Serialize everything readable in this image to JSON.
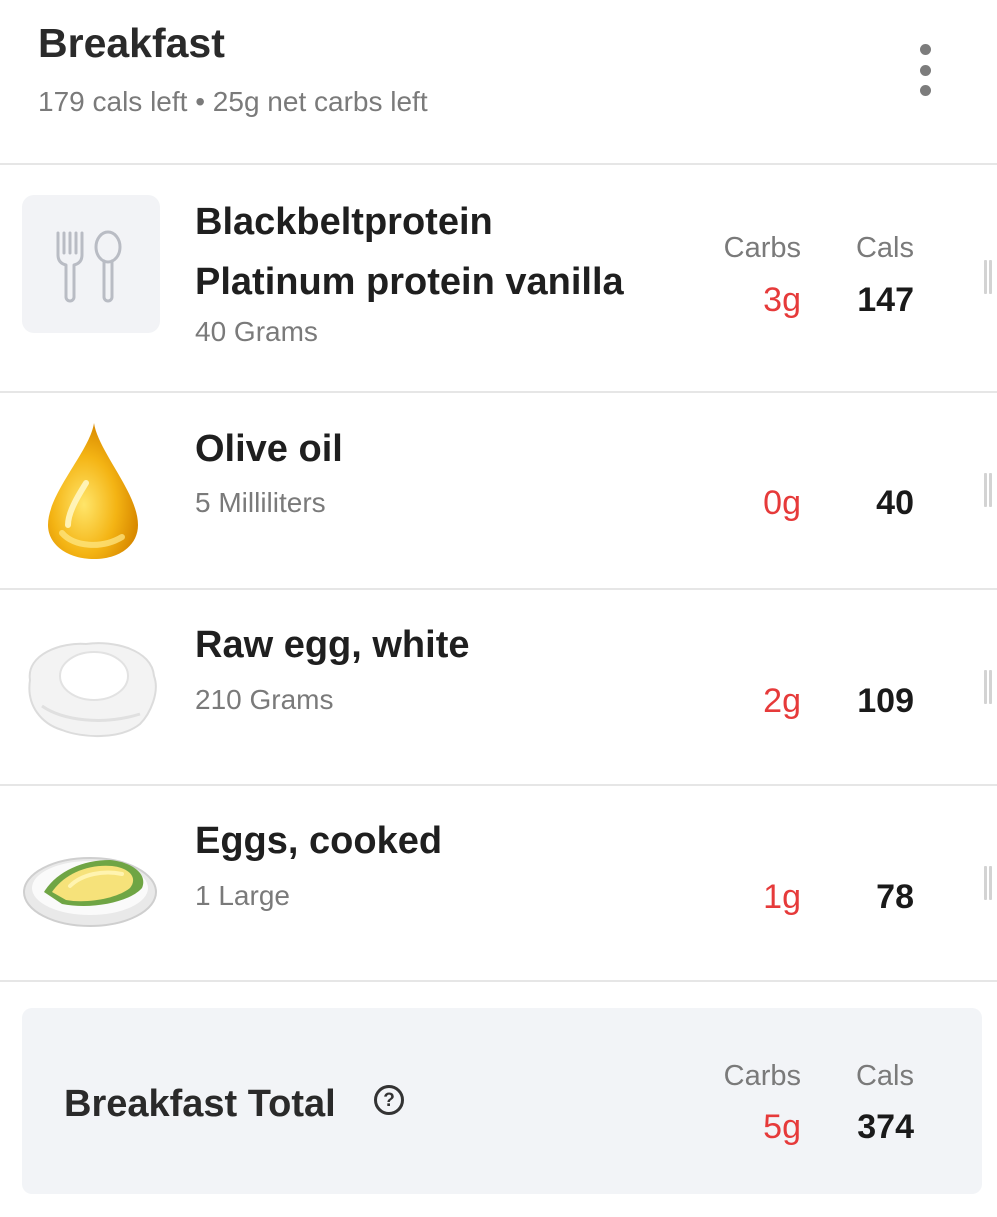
{
  "meal": {
    "title": "Breakfast",
    "cals_left": "179 cals left",
    "separator": "•",
    "carbs_left": "25g net carbs left",
    "menu_icon": "more-vertical-icon"
  },
  "columns": {
    "carbs": "Carbs",
    "cals": "Cals"
  },
  "items": [
    {
      "name_line1": "Blackbeltprotein",
      "name_line2": "Platinum protein vanilla",
      "amount": "40 Grams",
      "carbs": "3g",
      "cals": "147",
      "icon": "fork-spoon-icon"
    },
    {
      "name": "Olive oil",
      "amount": "5 Milliliters",
      "carbs": "0g",
      "cals": "40",
      "icon": "oil-drop-icon"
    },
    {
      "name": "Raw egg, white",
      "amount": "210 Grams",
      "carbs": "2g",
      "cals": "109",
      "icon": "egg-white-icon"
    },
    {
      "name": "Eggs, cooked",
      "amount": "1 Large",
      "carbs": "1g",
      "cals": "78",
      "icon": "cooked-eggs-icon"
    }
  ],
  "total": {
    "label": "Breakfast Total",
    "help_icon": "?",
    "carbs_label": "Carbs",
    "cals_label": "Cals",
    "carbs": "5g",
    "cals": "374"
  },
  "colors": {
    "carbs": "#e63a3a",
    "divider": "#e6e6e6",
    "total_bg": "#f2f4f7"
  }
}
